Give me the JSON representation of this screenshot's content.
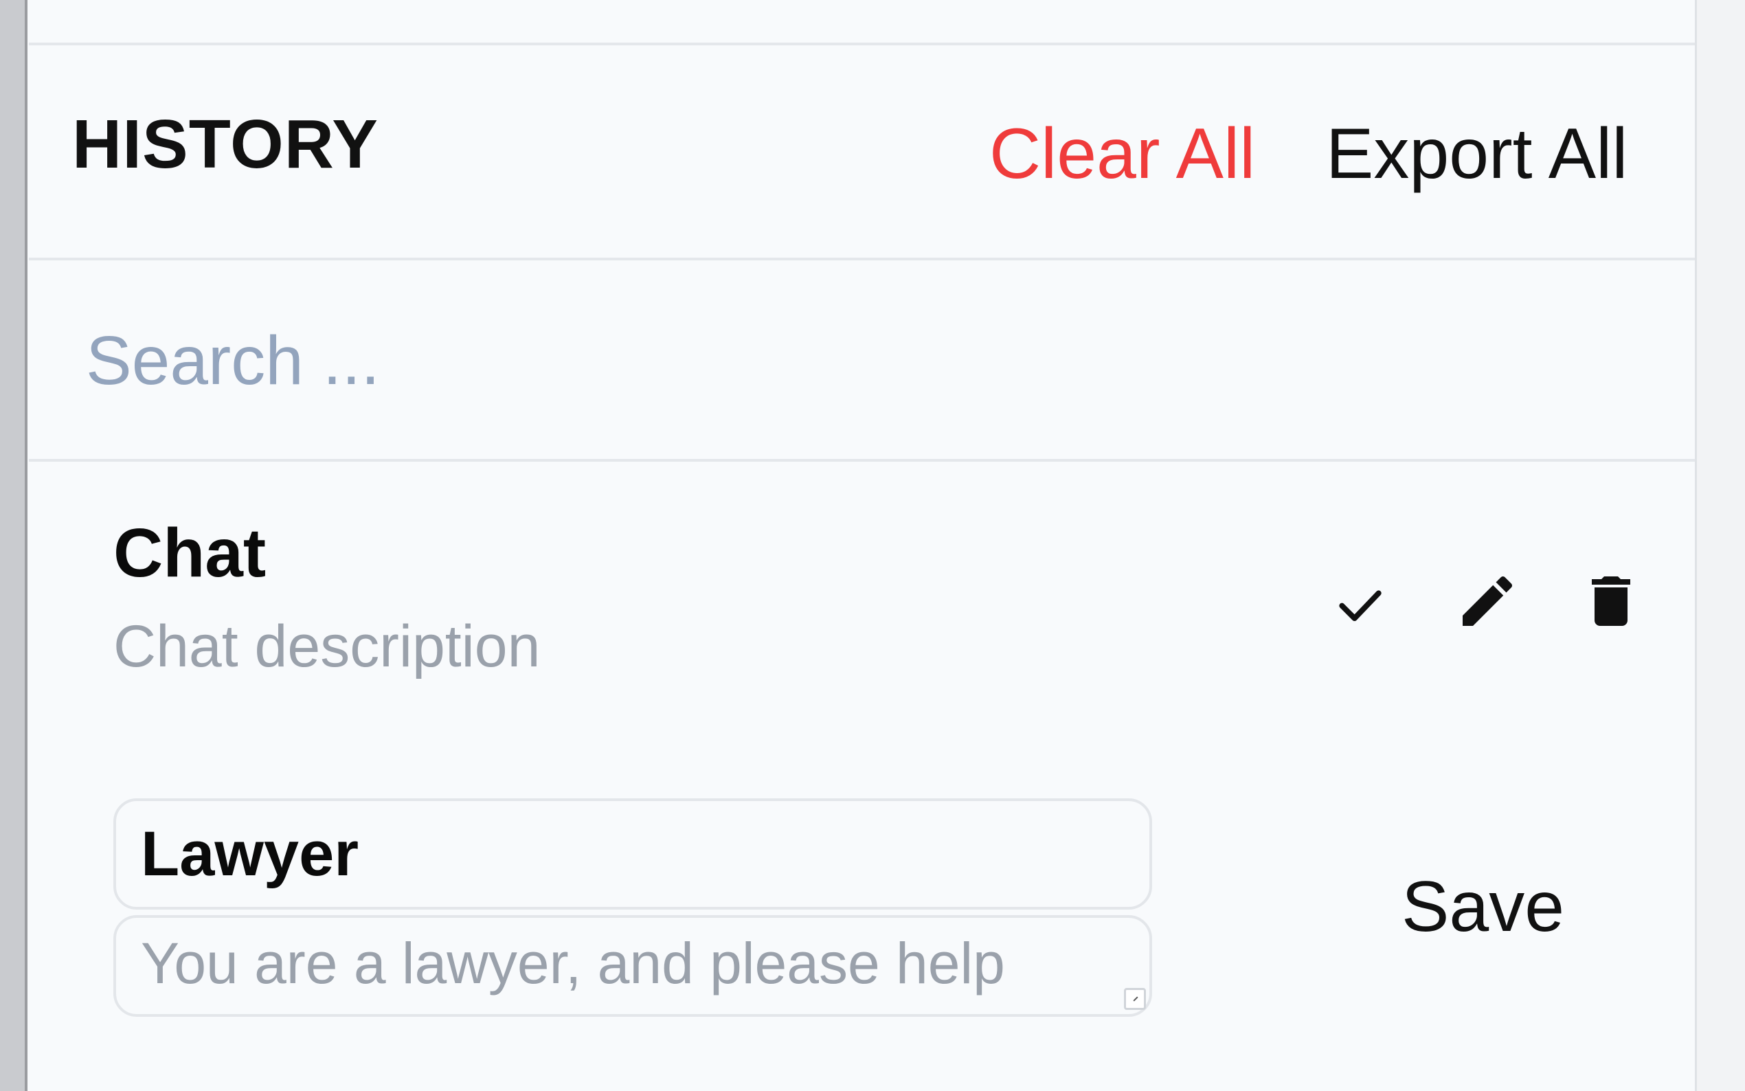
{
  "history": {
    "title": "HISTORY",
    "clear_all_label": "Clear All",
    "export_all_label": "Export All",
    "clear_all_color": "#ef3b3b"
  },
  "search": {
    "placeholder": "Search ...",
    "value": ""
  },
  "chat_item": {
    "title": "Chat",
    "description": "Chat description",
    "icons": [
      "check-icon",
      "pencil-icon",
      "trash-icon"
    ]
  },
  "edit_form": {
    "name_value": "Lawyer",
    "prompt_placeholder": "You are a lawyer, and please help",
    "prompt_value": "",
    "save_label": "Save"
  }
}
